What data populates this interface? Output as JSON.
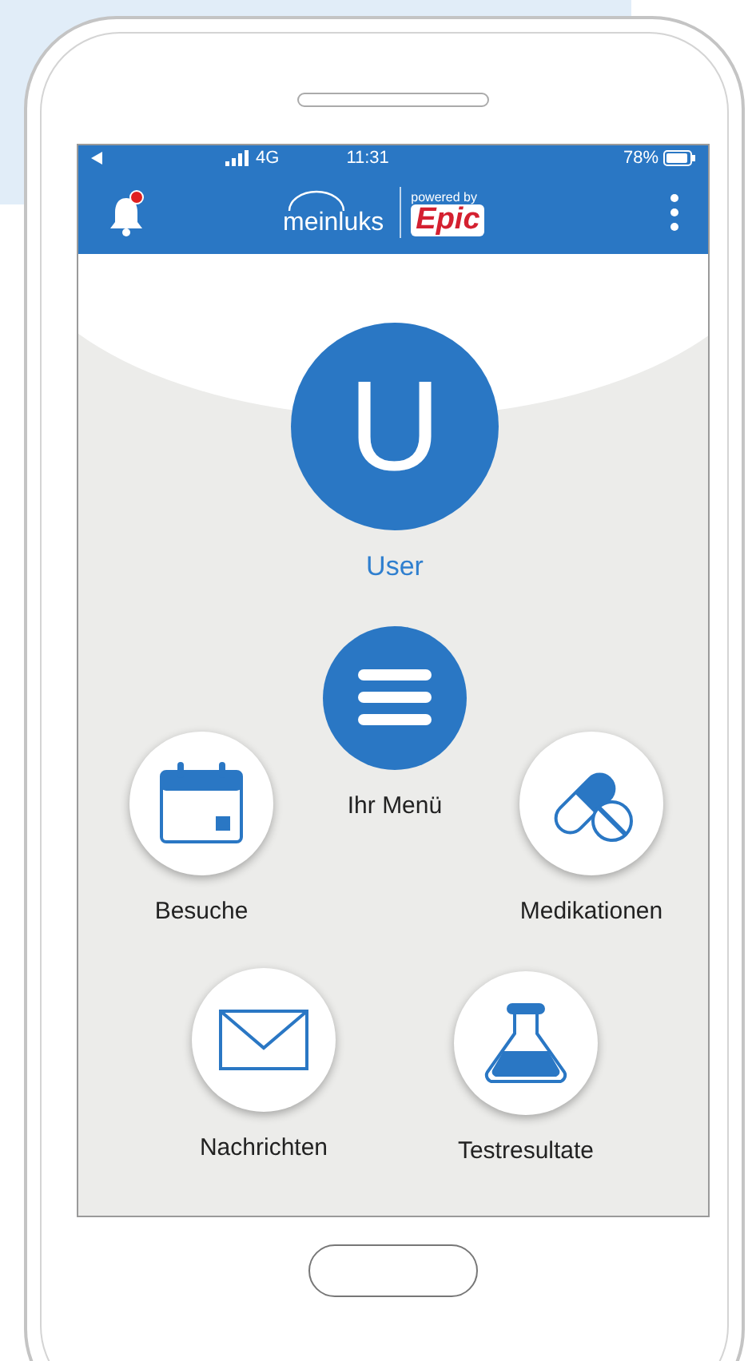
{
  "status_bar": {
    "network": "4G",
    "time": "11:31",
    "battery": "78%"
  },
  "header": {
    "notification_badge": true,
    "logo": "meinluks",
    "powered_by": "powered by",
    "partner": "Epic"
  },
  "profile": {
    "initial": "U",
    "name": "User"
  },
  "menu_items": [
    {
      "kind": "menu",
      "label": "Ihr Menü"
    },
    {
      "kind": "calendar",
      "label": "Besuche"
    },
    {
      "kind": "pill",
      "label": "Medikationen"
    },
    {
      "kind": "envelope",
      "label": "Nachrichten"
    },
    {
      "kind": "flask",
      "label": "Testresultate"
    }
  ]
}
